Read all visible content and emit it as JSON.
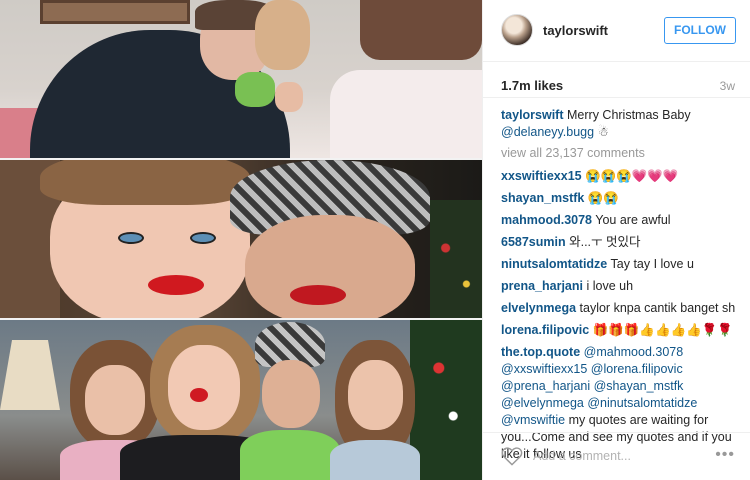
{
  "post": {
    "username": "taylorswift",
    "follow_label": "FOLLOW",
    "likes": "1.7m likes",
    "time_ago": "3w",
    "caption_user": "taylorswift",
    "caption_text": "Merry Christmas Baby",
    "caption_mention": "@delaneyy.bugg",
    "caption_emoji": "☃",
    "view_all": "view all 23,137 comments",
    "add_comment_placeholder": "Add a comment...",
    "more_label": "•••"
  },
  "comments": [
    {
      "user": "xxswiftiexx15",
      "text": "😭😭😭💗💗💗"
    },
    {
      "user": "shayan_mstfk",
      "text": "😭😭"
    },
    {
      "user": "mahmood.3078",
      "text": "You are awful"
    },
    {
      "user": "6587sumin",
      "text": "와...ㅜ 멋있다"
    },
    {
      "user": "ninutsalomtatidze",
      "text": "Tay tay I love u"
    },
    {
      "user": "prena_harjani",
      "text": "i love uh"
    },
    {
      "user": "elvelynmega",
      "text": "taylor knpa cantik banget sh"
    },
    {
      "user": "lorena.filipovic",
      "text": "🎁🎁🎁👍👍👍👍🌹🌹"
    }
  ],
  "quote_comment": {
    "user": "the.top.quote",
    "mentions": "@mahmood.3078 @xxswiftiexx15 @lorena.filipovic @prena_harjani @shayan_mstfk @elvelynmega @ninutsalomtatidze @vmswiftie",
    "text": "my quotes are waiting for you...Come and see my quotes and if you like it follow us"
  },
  "icons": {
    "like": "heart-icon",
    "more": "more-options-icon",
    "avatar": "profile-avatar"
  },
  "colors": {
    "link": "#125688",
    "follow": "#3897f0"
  }
}
